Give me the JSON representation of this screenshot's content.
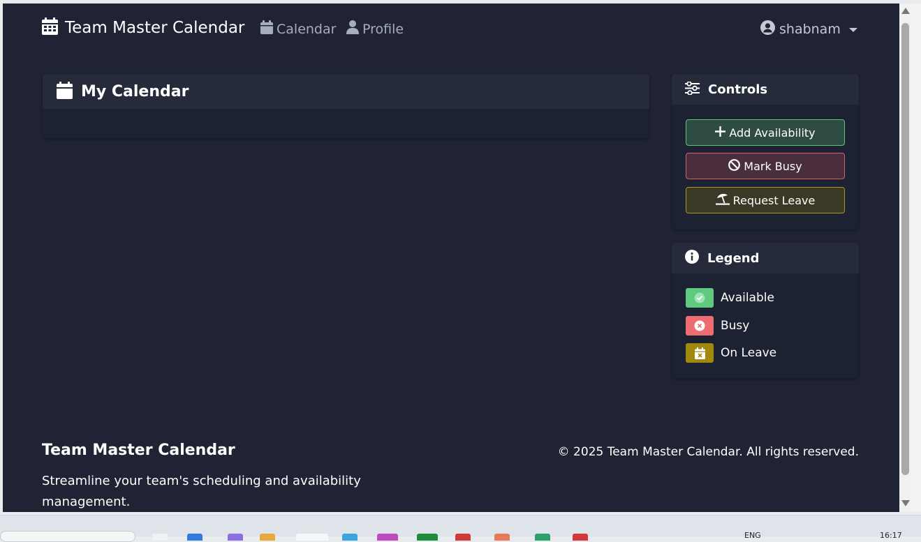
{
  "navbar": {
    "brand": "Team Master Calendar",
    "links": [
      {
        "label": "Calendar",
        "icon": "calendar-icon"
      },
      {
        "label": "Profile",
        "icon": "user-icon"
      }
    ],
    "user": {
      "name": "shabnam",
      "icon": "user-circle-icon"
    }
  },
  "main": {
    "title": "My Calendar",
    "icon": "calendar-icon"
  },
  "controls": {
    "title": "Controls",
    "icon": "sliders-icon",
    "buttons": [
      {
        "label": "Add Availability",
        "icon": "plus-icon"
      },
      {
        "label": "Mark Busy",
        "icon": "ban-icon"
      },
      {
        "label": "Request Leave",
        "icon": "umbrella-beach-icon"
      }
    ]
  },
  "legend": {
    "title": "Legend",
    "icon": "info-circle-icon",
    "items": [
      {
        "label": "Available",
        "color": "#5ec97f",
        "icon": "check-circle-icon"
      },
      {
        "label": "Busy",
        "color": "#ef6b72",
        "icon": "x-circle-icon"
      },
      {
        "label": "On Leave",
        "color": "#a1890f",
        "icon": "calendar-x-icon"
      }
    ]
  },
  "footer": {
    "title": "Team Master Calendar",
    "description": "Streamline your team's scheduling and availability management.",
    "copyright": "© 2025 Team Master Calendar. All rights reserved."
  },
  "taskbar": {
    "lang": "ENG",
    "time": "16:17"
  },
  "colors": {
    "background": "#1f2333",
    "card": "#1d2232",
    "card_header": "#262b3b",
    "available": "#5ec97f",
    "busy": "#ef6b72",
    "leave": "#a1890f"
  }
}
